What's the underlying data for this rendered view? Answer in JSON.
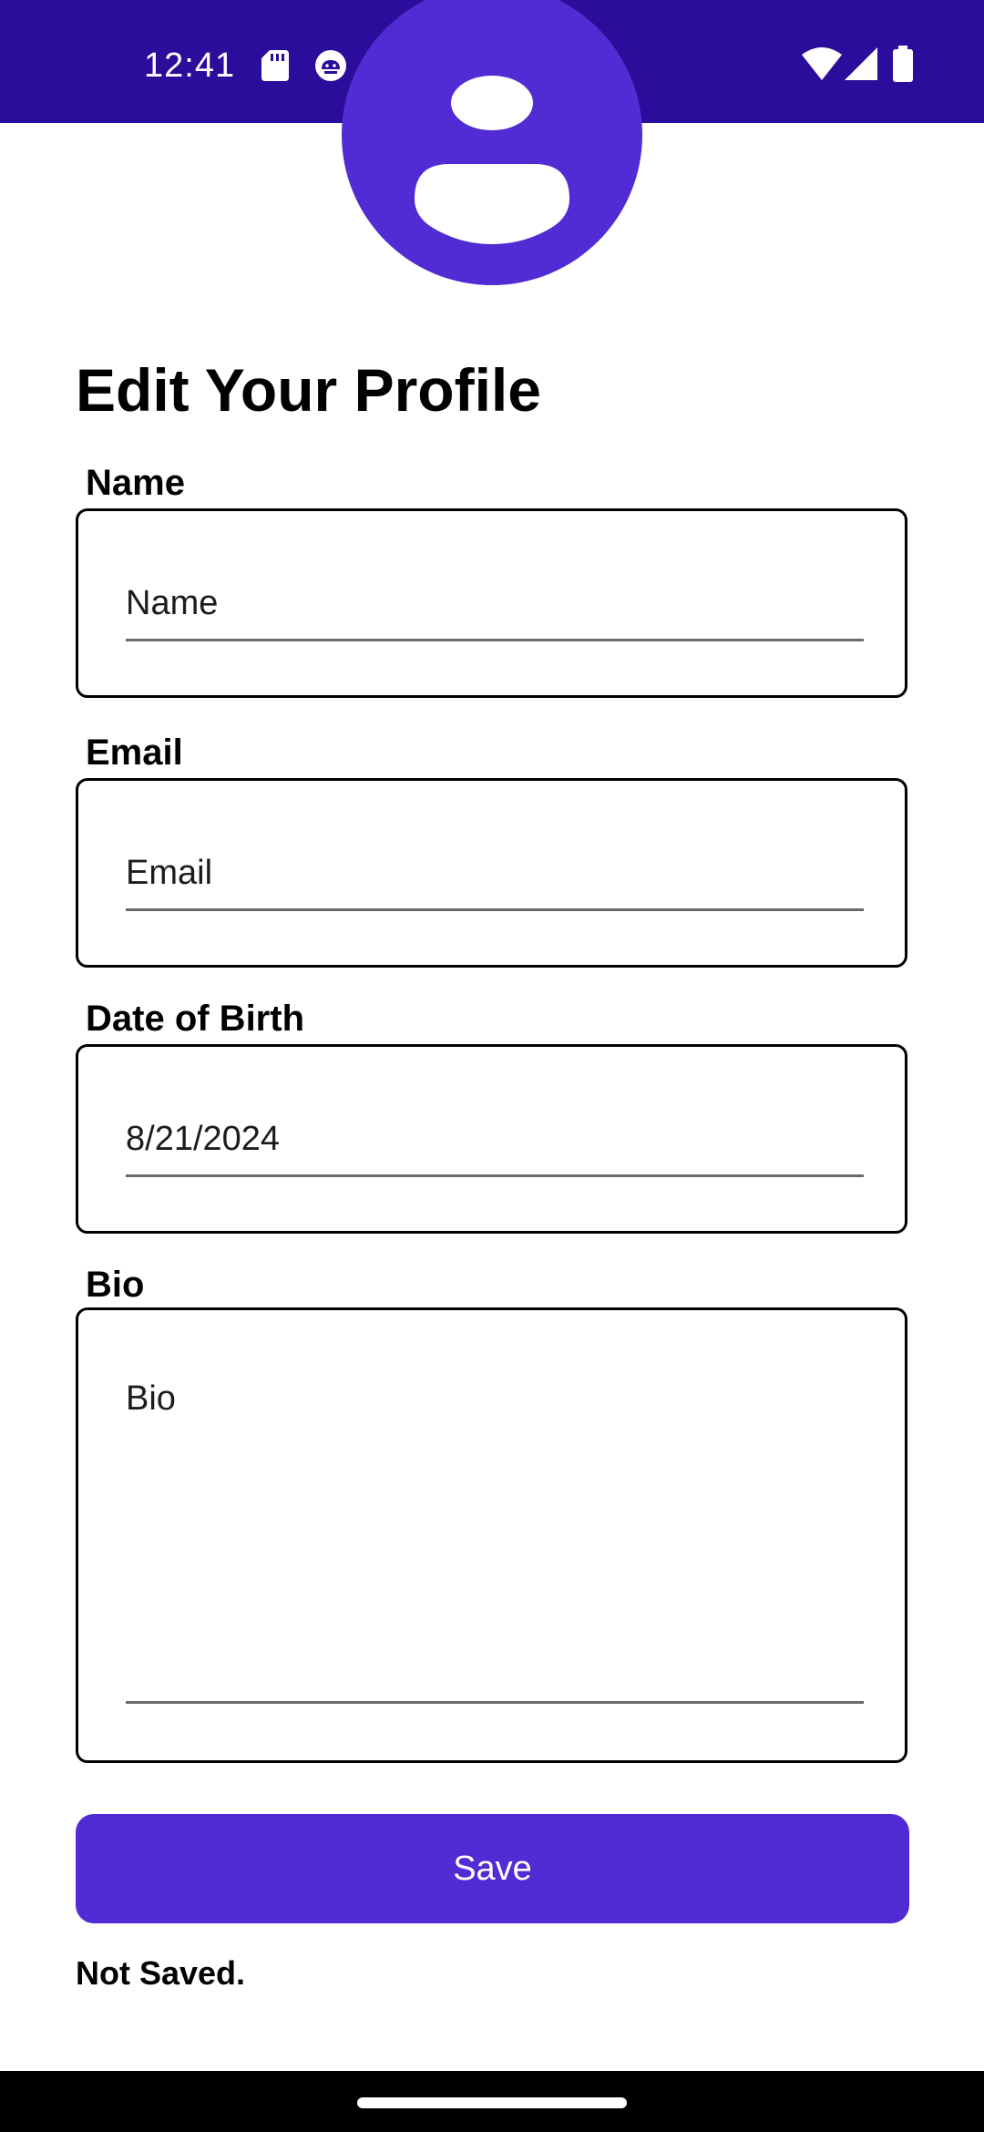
{
  "status_bar": {
    "time": "12:41",
    "icons": [
      "sd-card-icon",
      "android-debug-icon",
      "wifi-icon",
      "signal-icon",
      "battery-icon"
    ],
    "background": "#2a0d9a"
  },
  "page": {
    "title": "Edit Your Profile"
  },
  "form": {
    "name": {
      "label": "Name",
      "placeholder": "Name",
      "value": ""
    },
    "email": {
      "label": "Email",
      "placeholder": "Email",
      "value": ""
    },
    "dob": {
      "label": "Date of Birth",
      "value": "8/21/2024"
    },
    "bio": {
      "label": "Bio",
      "placeholder": "Bio",
      "value": ""
    }
  },
  "actions": {
    "save_label": "Save",
    "save_color": "#512bd4"
  },
  "status": {
    "message": "Not Saved."
  }
}
